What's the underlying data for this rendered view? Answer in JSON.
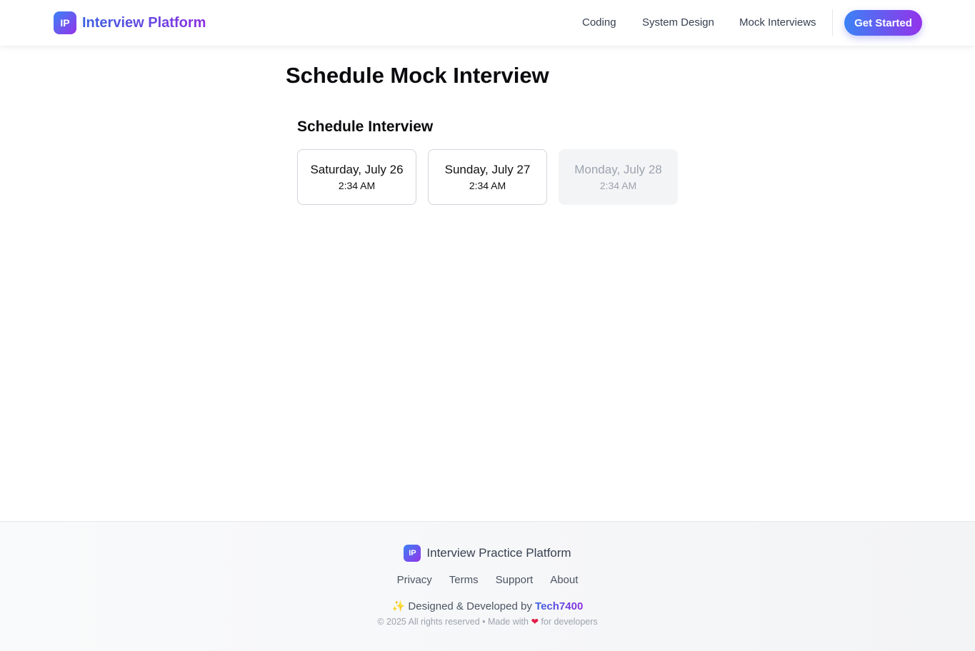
{
  "navbar": {
    "logo_text": "IP",
    "brand": "Interview Platform",
    "links": [
      "Coding",
      "System Design",
      "Mock Interviews"
    ],
    "cta_label": "Get Started"
  },
  "page": {
    "title": "Schedule Mock Interview",
    "section_title": "Schedule Interview",
    "slots": [
      {
        "date": "Saturday, July 26",
        "time": "2:34 AM",
        "available": true
      },
      {
        "date": "Sunday, July 27",
        "time": "2:34 AM",
        "available": true
      },
      {
        "date": "Monday, July 28",
        "time": "2:34 AM",
        "available": false
      }
    ]
  },
  "footer": {
    "logo_text": "IP",
    "name": "Interview Practice Platform",
    "links": [
      "Privacy",
      "Terms",
      "Support",
      "About"
    ],
    "credit_prefix": "Designed & Developed by",
    "credit_author": "Tech7400",
    "copyright_prefix": "© 2025 All rights reserved • Made with",
    "copyright_suffix": "for developers",
    "sparkle_glyph": "✨",
    "heart_glyph": "❤"
  },
  "colors": {
    "brand_gradient_start": "#3b82f6",
    "brand_gradient_end": "#9333ea",
    "disabled_slot_bg": "#f3f4f6"
  }
}
